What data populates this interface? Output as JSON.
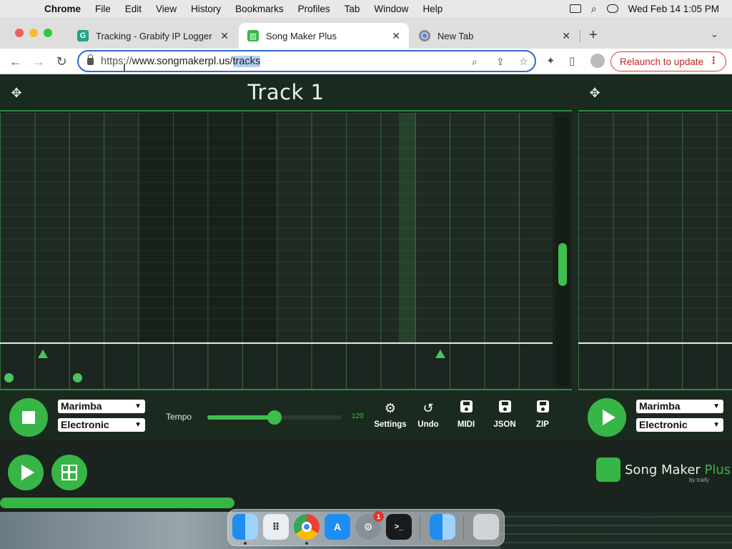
{
  "menubar": {
    "app_name": "Chrome",
    "items": [
      "File",
      "Edit",
      "View",
      "History",
      "Bookmarks",
      "Profiles",
      "Tab",
      "Window",
      "Help"
    ],
    "clock": "Wed Feb 14  1:05 PM"
  },
  "tabs": [
    {
      "title": "Tracking - Grabify IP Logger &",
      "favicon": "G",
      "active": false
    },
    {
      "title": "Song Maker Plus",
      "favicon": "songmaker-icon",
      "active": true
    },
    {
      "title": "New Tab",
      "favicon": "chrome-icon",
      "active": false
    }
  ],
  "toolbar": {
    "url_scheme": "https://",
    "url_host": "www.songmakerpl.us/",
    "url_path": "tracks",
    "relaunch_label": "Relaunch to update"
  },
  "track": {
    "title": "Track 1"
  },
  "controls": {
    "instrument": "Marimba",
    "percussion": "Electronic",
    "tempo_label": "Tempo",
    "tempo_value": "120",
    "tempo_fraction": 0.5,
    "settings_label": "Settings",
    "undo_label": "Undo",
    "midi_label": "MIDI",
    "json_label": "JSON",
    "zip_label": "ZIP"
  },
  "track2": {
    "instrument": "Marimba",
    "percussion": "Electronic"
  },
  "footer": {
    "logo_word1": "Song Maker ",
    "logo_word2": "Plus",
    "logo_by": "by traify",
    "progress_fraction": 0.32
  },
  "dock": {
    "items": [
      "finder",
      "launchpad",
      "chrome",
      "app-store",
      "system-settings",
      "terminal",
      "finder-2",
      "trash"
    ],
    "settings_badge": "1"
  },
  "colors": {
    "accent": "#37b547",
    "grid_line": "#2f8a3a",
    "relaunch": "#c5221f",
    "url_focus": "#2f6bd3"
  }
}
